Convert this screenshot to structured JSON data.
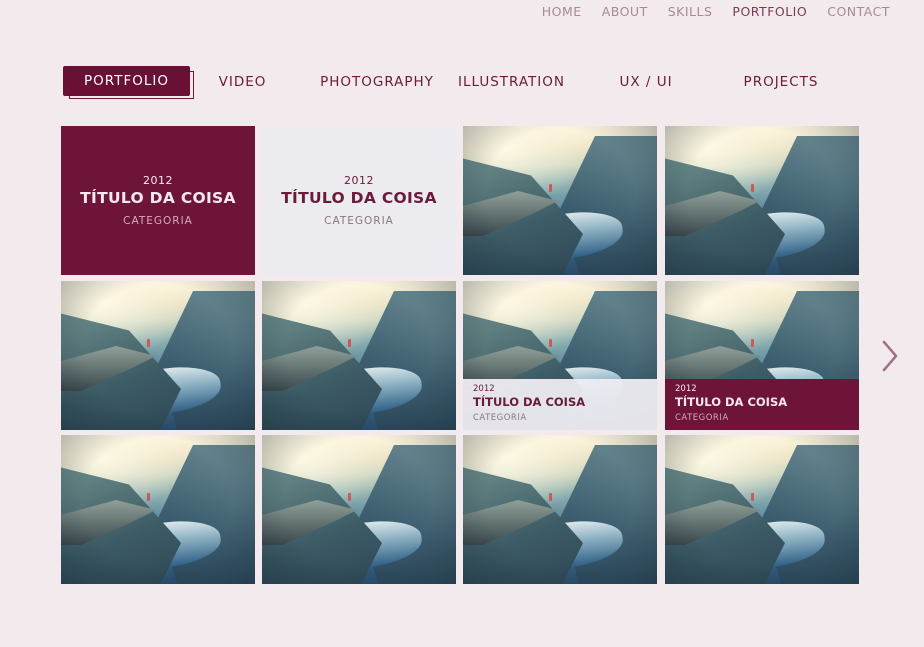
{
  "top_nav": [
    {
      "label": "HOME",
      "active": false
    },
    {
      "label": "ABOUT",
      "active": false
    },
    {
      "label": "SKILLS",
      "active": false
    },
    {
      "label": "PORTFOLIO",
      "active": true
    },
    {
      "label": "CONTACT",
      "active": false
    }
  ],
  "tabs": [
    {
      "label": "PORTFOLIO",
      "active": true
    },
    {
      "label": "VIDEO",
      "active": false
    },
    {
      "label": "PHOTOGRAPHY",
      "active": false
    },
    {
      "label": "ILLUSTRATION",
      "active": false
    },
    {
      "label": "UX / UI",
      "active": false
    },
    {
      "label": "PROJECTS",
      "active": false
    }
  ],
  "tiles": [
    {
      "overlay": "full-dark",
      "year": "2012",
      "title": "TÍTULO DA COISA",
      "category": "CATEGORIA"
    },
    {
      "overlay": "full-light",
      "year": "2012",
      "title": "TÍTULO DA COISA",
      "category": "CATEGORIA"
    },
    {
      "overlay": "none"
    },
    {
      "overlay": "none"
    },
    {
      "overlay": "none"
    },
    {
      "overlay": "none"
    },
    {
      "overlay": "bottom-light",
      "year": "2012",
      "title": "TÍTULO DA COISA",
      "category": "CATEGORIA"
    },
    {
      "overlay": "bottom-dark",
      "year": "2012",
      "title": "TÍTULO DA COISA",
      "category": "CATEGORIA"
    },
    {
      "overlay": "none"
    },
    {
      "overlay": "none"
    },
    {
      "overlay": "none"
    },
    {
      "overlay": "none"
    }
  ],
  "colors": {
    "accent": "#6e1438",
    "background": "#f2eaec",
    "nav_text": "#a8889a"
  },
  "icons": {
    "next": "chevron-right-icon"
  }
}
